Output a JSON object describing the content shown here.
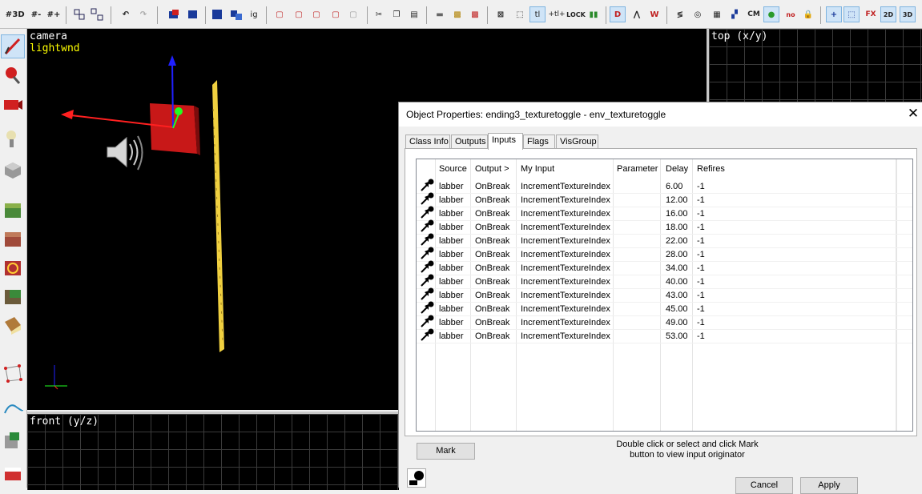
{
  "toolbar": {
    "icons": [
      "grid-icon",
      "3d-grid-icon",
      "smaller-grid-icon",
      "larger-grid-icon",
      "group-icon",
      "ungroup-icon",
      "undo-icon",
      "redo-icon",
      "carve-icon",
      "clip-icon",
      "texture-lock-icon",
      "hide-icon",
      "show-icon",
      "ignore-groups-icon",
      "cut-icon",
      "copy-icon",
      "paste-icon",
      "vertex-icon",
      "snap-icon",
      "selection-icon",
      "toggle-texture-icon",
      "run-map-icon",
      "cordon-icon",
      "compile-icon",
      "entity-report-icon",
      "map-check-icon",
      "apply-icon"
    ],
    "ignore_groups_label": "ig",
    "cm_label": "CM",
    "ttl_label": "tl",
    "ttl2_label": "+tl+"
  },
  "views": {
    "camera_label": "camera",
    "camera_sublabel": "lightwnd",
    "top_label": "top (x/y)",
    "front_label": "front (y/z)"
  },
  "dialog": {
    "title": "Object Properties: ending3_texturetoggle - env_texturetoggle",
    "close_label": "✕",
    "tabs": [
      {
        "label": "Class Info"
      },
      {
        "label": "Outputs"
      },
      {
        "label": "Inputs"
      },
      {
        "label": "Flags"
      },
      {
        "label": "VisGroup"
      }
    ],
    "active_tab": "Inputs",
    "columns": {
      "source": "Source",
      "output": "Output  >",
      "my_input": "My Input",
      "parameter": "Parameter",
      "delay": "Delay",
      "refires": "Refires"
    },
    "rows": [
      {
        "source": "labber",
        "output": "OnBreak",
        "my_input": "IncrementTextureIndex",
        "parameter": "",
        "delay": "6.00",
        "refires": "-1"
      },
      {
        "source": "labber",
        "output": "OnBreak",
        "my_input": "IncrementTextureIndex",
        "parameter": "",
        "delay": "12.00",
        "refires": "-1"
      },
      {
        "source": "labber",
        "output": "OnBreak",
        "my_input": "IncrementTextureIndex",
        "parameter": "",
        "delay": "16.00",
        "refires": "-1"
      },
      {
        "source": "labber",
        "output": "OnBreak",
        "my_input": "IncrementTextureIndex",
        "parameter": "",
        "delay": "18.00",
        "refires": "-1"
      },
      {
        "source": "labber",
        "output": "OnBreak",
        "my_input": "IncrementTextureIndex",
        "parameter": "",
        "delay": "22.00",
        "refires": "-1"
      },
      {
        "source": "labber",
        "output": "OnBreak",
        "my_input": "IncrementTextureIndex",
        "parameter": "",
        "delay": "28.00",
        "refires": "-1"
      },
      {
        "source": "labber",
        "output": "OnBreak",
        "my_input": "IncrementTextureIndex",
        "parameter": "",
        "delay": "34.00",
        "refires": "-1"
      },
      {
        "source": "labber",
        "output": "OnBreak",
        "my_input": "IncrementTextureIndex",
        "parameter": "",
        "delay": "40.00",
        "refires": "-1"
      },
      {
        "source": "labber",
        "output": "OnBreak",
        "my_input": "IncrementTextureIndex",
        "parameter": "",
        "delay": "43.00",
        "refires": "-1"
      },
      {
        "source": "labber",
        "output": "OnBreak",
        "my_input": "IncrementTextureIndex",
        "parameter": "",
        "delay": "45.00",
        "refires": "-1"
      },
      {
        "source": "labber",
        "output": "OnBreak",
        "my_input": "IncrementTextureIndex",
        "parameter": "",
        "delay": "49.00",
        "refires": "-1"
      },
      {
        "source": "labber",
        "output": "OnBreak",
        "my_input": "IncrementTextureIndex",
        "parameter": "",
        "delay": "53.00",
        "refires": "-1"
      }
    ],
    "mark_label": "Mark",
    "hint_line1": "Double click or select and click Mark",
    "hint_line2": "button to view input originator",
    "cancel_label": "Cancel",
    "apply_label": "Apply"
  },
  "colors": {
    "camera_label": "#ffffff",
    "sublabel": "#ffff00",
    "viewport_bg": "#000000",
    "axis_red": "#ff2020",
    "axis_blue": "#2020ff",
    "axis_green": "#20ff20"
  }
}
